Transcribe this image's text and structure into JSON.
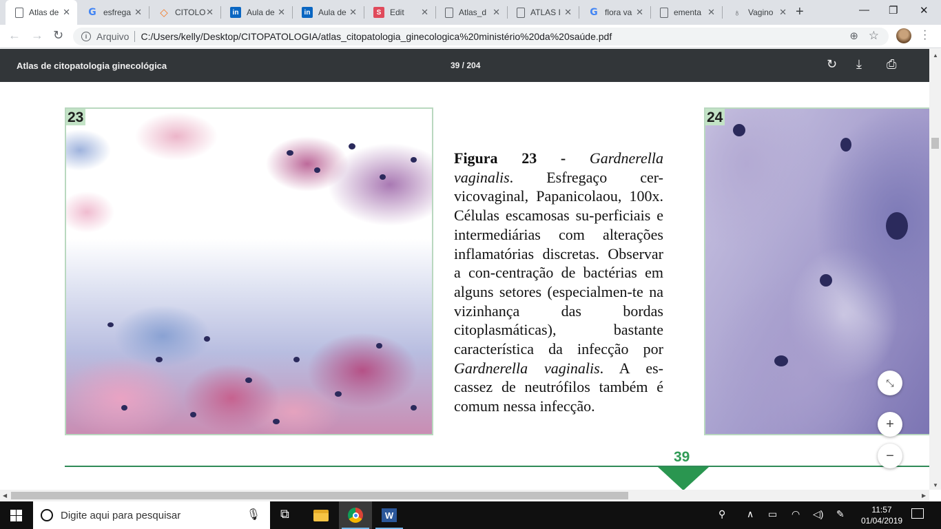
{
  "browser": {
    "tabs": [
      {
        "title": "Atlas de",
        "favicon": "pdf-doc-icon",
        "active": true
      },
      {
        "title": "esfrega",
        "favicon": "google-icon"
      },
      {
        "title": "CITOLO",
        "favicon": "citologia-site-icon"
      },
      {
        "title": "Aula de",
        "favicon": "linkedin-icon"
      },
      {
        "title": "Aula de",
        "favicon": "linkedin-icon"
      },
      {
        "title": "Edit",
        "favicon": "s-app-icon"
      },
      {
        "title": "Atlas_d",
        "favicon": "pdf-doc-icon"
      },
      {
        "title": "ATLAS I",
        "favicon": "pdf-doc-icon"
      },
      {
        "title": "flora va",
        "favicon": "google-icon"
      },
      {
        "title": "ementa",
        "favicon": "pdf-doc-icon"
      },
      {
        "title": "Vagino",
        "favicon": "vagino-site-icon"
      }
    ],
    "new_tab_symbol": "+",
    "security_label": "Arquivo",
    "url": "C:/Users/kelly/Desktop/CITOPATOLOGIA/atlas_citopatologia_ginecologica%20ministério%20da%20saúde.pdf"
  },
  "pdf_viewer": {
    "title": "Atlas de citopatologia ginecológica",
    "page_indicator": "39 / 204",
    "current_page": 39,
    "total_pages": 204
  },
  "page": {
    "figure_23_label": "23",
    "figure_24_label": "24",
    "caption": {
      "figure_ref": "Figura 23 -",
      "species_1": "Gardnerella vaginalis",
      "text_1": ". Esfregaço cer-vicovaginal, Papanicolaou, 100x. Células escamosas su-perficiais e intermediárias com alterações inflamatórias discretas. Observar a con-centração de bactérias em alguns setores (especialmen-te na vizinhança das bordas citoplasmáticas), bastante característica da infecção por",
      "species_2": "Gardnerella vaginalis",
      "text_2": ". A es-cassez de neutrófilos também é comum nessa infecção."
    },
    "page_number": "39"
  },
  "taskbar": {
    "search_placeholder": "Digite aqui para pesquisar",
    "time": "11:57",
    "date": "01/04/2019"
  },
  "colors": {
    "pdf_toolbar": "#323639",
    "figure_label_bg": "#c3e3c6",
    "page_accent": "#2a9650"
  }
}
